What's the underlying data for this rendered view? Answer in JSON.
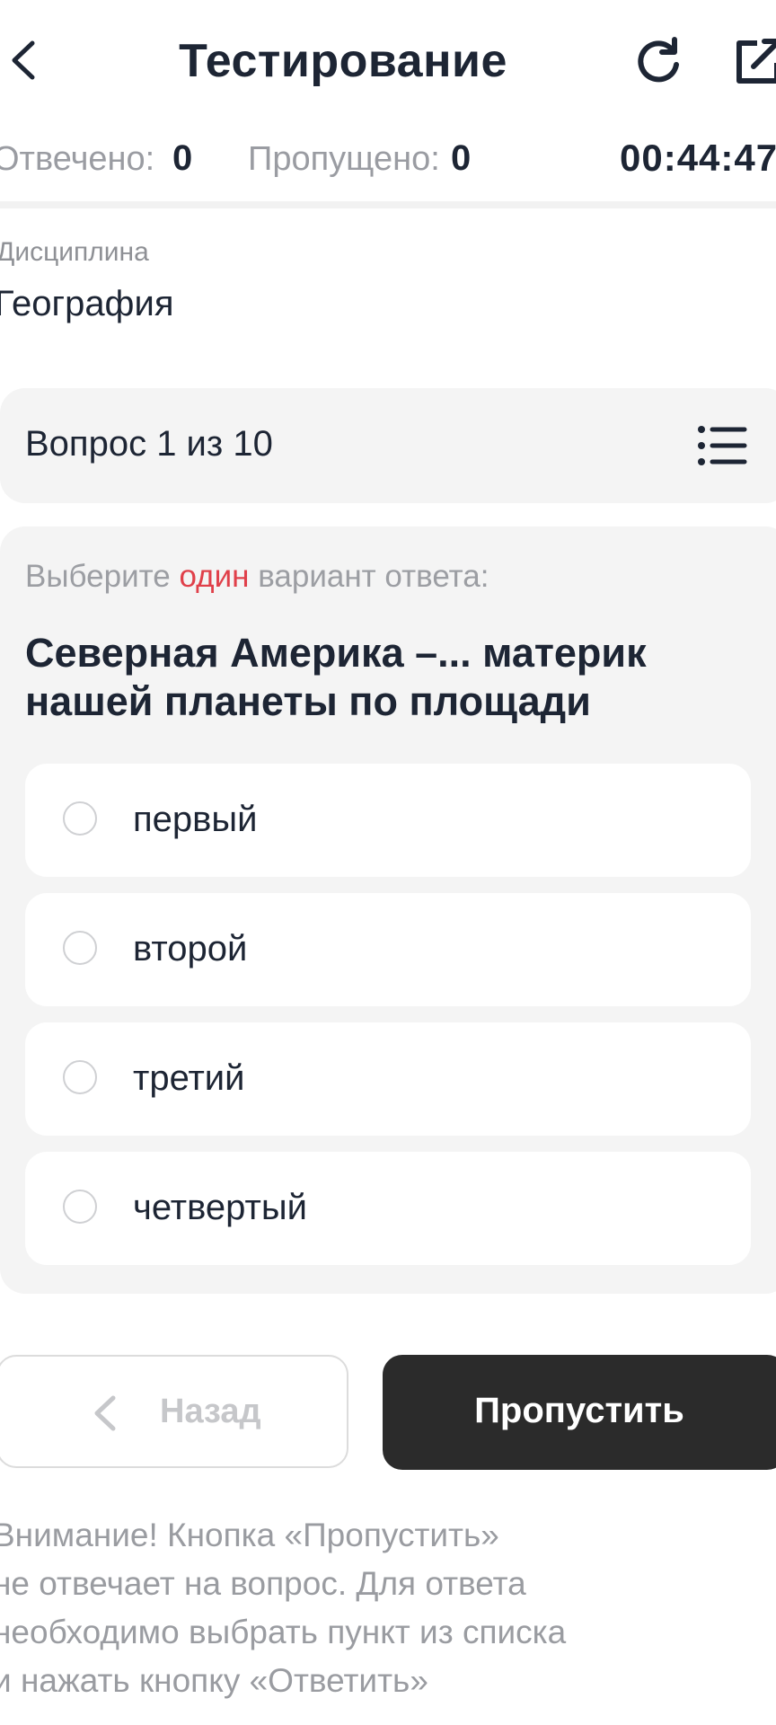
{
  "header": {
    "title": "Тестирование",
    "back_icon": "chevron-left-icon",
    "refresh_icon": "refresh-icon",
    "share_icon": "external-link-icon"
  },
  "stats": {
    "answered_label": "Отвечено:",
    "answered_value": "0",
    "skipped_label": "Пропущено:",
    "skipped_value": "0",
    "timer": "00:44:47"
  },
  "discipline": {
    "label": "Дисциплина",
    "value": "География"
  },
  "question": {
    "counter": "Вопрос 1 из 10",
    "list_icon": "list-icon",
    "instruction_prefix": "Выберите ",
    "instruction_accent": "один",
    "instruction_suffix": " вариант ответа:",
    "text": "Северная Америка –... материк нашей планеты по площади",
    "options": [
      {
        "label": "первый",
        "selected": false
      },
      {
        "label": "второй",
        "selected": false
      },
      {
        "label": "третий",
        "selected": false
      },
      {
        "label": "четвертый",
        "selected": false
      }
    ]
  },
  "actions": {
    "back_label": "Назад",
    "skip_label": "Пропустить"
  },
  "notice": {
    "lines": [
      "Внимание! Кнопка «Пропустить»",
      "не отвечает на вопрос. Для ответа",
      "необходимо выбрать пункт из списка",
      "и нажать кнопку «Ответить»"
    ]
  },
  "colors": {
    "text_primary": "#1d2534",
    "accent_red": "#e0404a",
    "card_background": "#f4f4f4",
    "button_dark": "#2b2b2b"
  }
}
